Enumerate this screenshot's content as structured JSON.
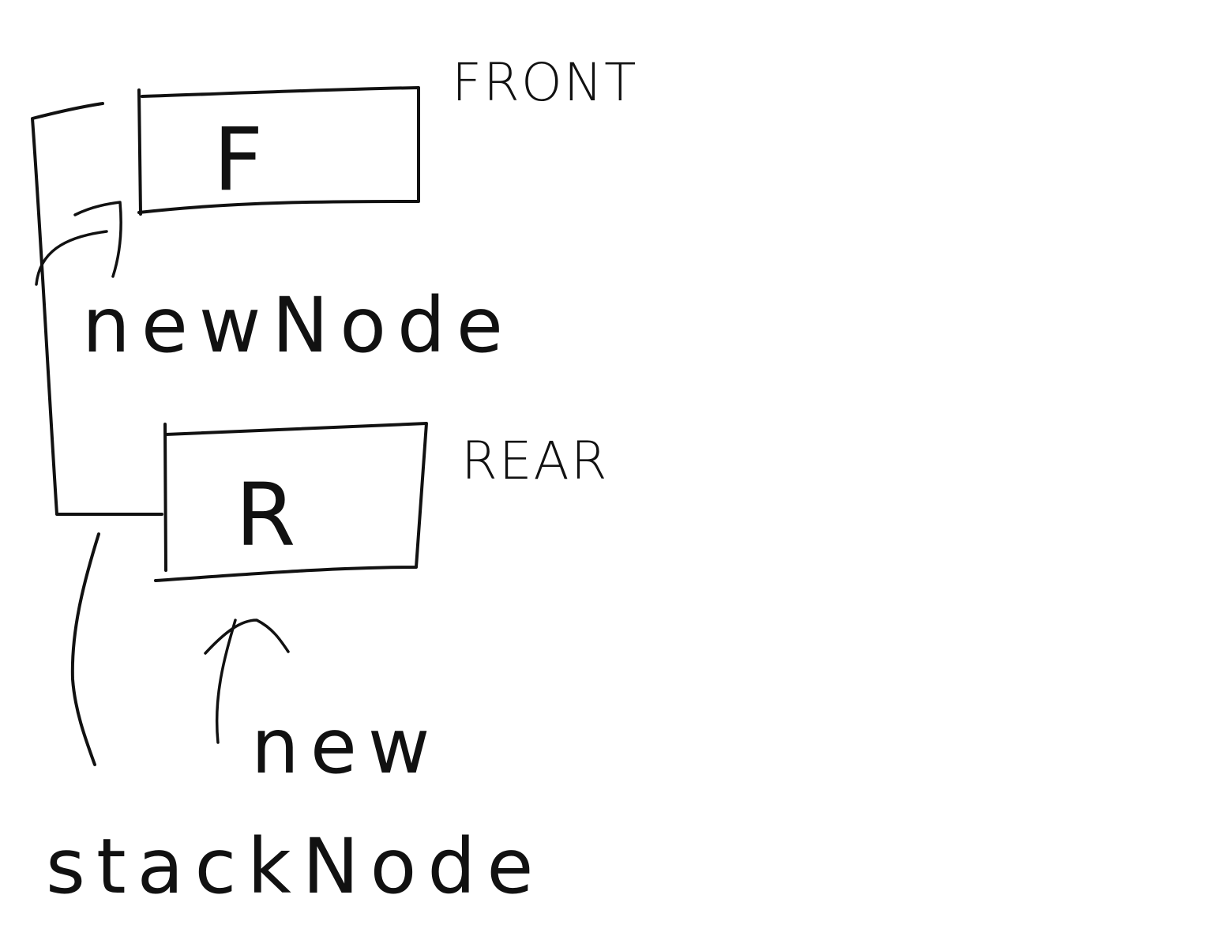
{
  "labels": {
    "front": "FRONT",
    "rear": "REAR",
    "new_node_top": "newNode",
    "new_bottom": "new",
    "stack_node": "stackNode"
  },
  "nodes": {
    "front_value": "F",
    "rear_value": "R"
  },
  "colors": {
    "background": "#ffffff",
    "ink": "#111111"
  }
}
